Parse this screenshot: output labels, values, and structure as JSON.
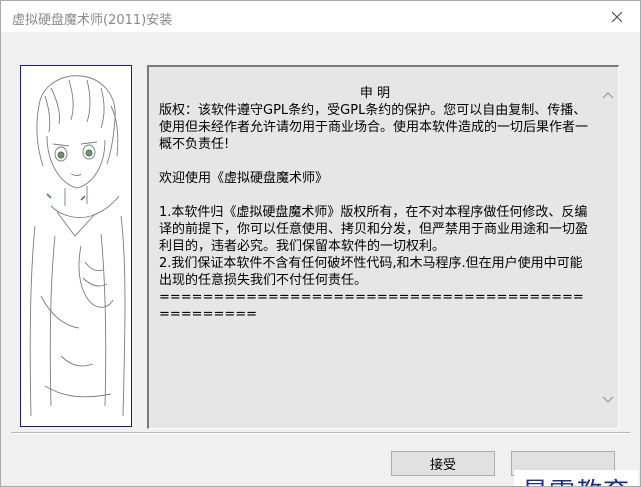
{
  "window": {
    "title": "虚拟硬盘魔术师(2011)安装",
    "close_icon": "close-icon"
  },
  "side_image": {
    "description_icon": "anime-girl-illustration"
  },
  "license": {
    "heading": "申 明",
    "paragraphs": [
      "版权：该软件遵守GPL条约，受GPL条约的保护。您可以自由复制、传播、使用但未经作者允许请勿用于商业场合。使用本软件造成的一切后果作者一概不负责任!",
      "",
      "欢迎使用《虚拟硬盘魔术师》",
      "",
      "1.本软件归《虚拟硬盘魔术师》版权所有，在不对本程序做任何修改、反编译的前提下，你可以任意使用、拷贝和分发，但严禁用于商业用途和一切盈利目的，违者必究。我们保留本软件的一切权利。",
      "2.我们保证本软件不含有任何破坏性代码,和木马程序.但在用户使用中可能出现的任意损失我们不付任何责任。",
      "================================================"
    ]
  },
  "buttons": {
    "accept": "接受",
    "cancel": ""
  },
  "watermark": {
    "text": "最需教育"
  },
  "colors": {
    "title_text": "#8a8a8a",
    "panel_bg": "#e6e6e6",
    "image_border": "#1c1c78",
    "watermark": "#1b2c8f"
  }
}
